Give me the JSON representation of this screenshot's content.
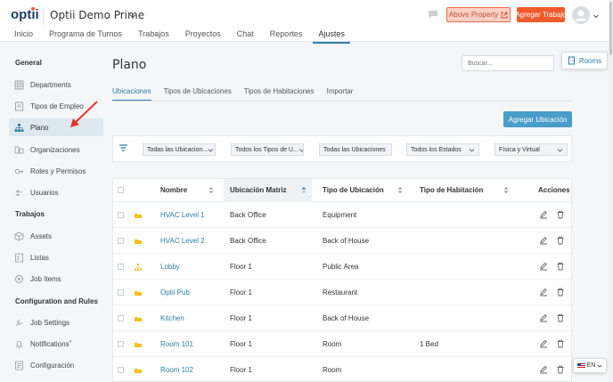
{
  "header": {
    "logo_text": "optii",
    "app_name": "Optii Demo Prime",
    "above_property_label": "Above Property",
    "add_work_label": "Agregar Trabajo",
    "nav": [
      {
        "label": "Inicio"
      },
      {
        "label": "Programa de Turnos"
      },
      {
        "label": "Trabajos"
      },
      {
        "label": "Proyectos"
      },
      {
        "label": "Chat"
      },
      {
        "label": "Reportes"
      },
      {
        "label": "Ajustes",
        "active": true
      }
    ]
  },
  "sidebar": {
    "sections": [
      {
        "title": "General",
        "items": [
          {
            "label": "Departments",
            "icon": "grid-icon"
          },
          {
            "label": "Tipos de Empleo",
            "icon": "id-card-icon"
          },
          {
            "label": "Plano",
            "icon": "org-chart-icon",
            "active": true
          },
          {
            "label": "Organizaciones",
            "icon": "organization-icon"
          },
          {
            "label": "Roles y Permisos",
            "icon": "key-icon"
          },
          {
            "label": "Usuarios",
            "icon": "users-icon"
          }
        ]
      },
      {
        "title": "Trabajos",
        "items": [
          {
            "label": "Assets",
            "icon": "cube-icon"
          },
          {
            "label": "Listas",
            "icon": "checklist-icon"
          },
          {
            "label": "Job Items",
            "icon": "badge-icon"
          }
        ]
      },
      {
        "title": "Configuration and Rules",
        "items": [
          {
            "label": "Job Settings",
            "icon": "wrench-icon"
          },
          {
            "label": "Notifications",
            "icon": "bell-icon",
            "superscript": "+"
          },
          {
            "label": "Configuración",
            "icon": "settings-list-icon"
          }
        ]
      }
    ]
  },
  "main": {
    "title": "Plano",
    "search_placeholder": "Buscar...",
    "rooms_label": "Rooms",
    "subtabs": [
      {
        "label": "Ubicaciones",
        "active": true
      },
      {
        "label": "Tipos de Ubicaciones"
      },
      {
        "label": "Tipos de Habitaciones"
      },
      {
        "label": "Importar"
      }
    ],
    "add_location_label": "Agregar Ubicación",
    "filters": [
      "Todas las Ubicacion...",
      "Todos los Tipos de U...",
      "Todas las Ubicaciones",
      "Todos los Estados",
      "Física y Virtual"
    ],
    "table": {
      "columns": [
        "Nombre",
        "Ubicación Matriz",
        "Tipo de Ubicación",
        "Tipo de Habitación",
        "Acciones"
      ],
      "rows": [
        {
          "name": "HVAC Level 1",
          "parent": "Back Office",
          "type": "Equipment",
          "room_type": "",
          "icon": "folder-icon"
        },
        {
          "name": "HVAC Level 2",
          "parent": "Back Office",
          "type": "Back of House",
          "room_type": "",
          "icon": "folder-icon"
        },
        {
          "name": "Lobby",
          "parent": "Floor 1",
          "type": "Public Area",
          "room_type": "",
          "icon": "hierarchy-icon"
        },
        {
          "name": "Optii Pub",
          "parent": "Floor 1",
          "type": "Restaurant",
          "room_type": "",
          "icon": "folder-icon"
        },
        {
          "name": "Kitchen",
          "parent": "Floor 1",
          "type": "Back of House",
          "room_type": "",
          "icon": "folder-icon"
        },
        {
          "name": "Room 101",
          "parent": "Floor 1",
          "type": "Room",
          "room_type": "1 Bed",
          "icon": "folder-icon"
        },
        {
          "name": "Room 102",
          "parent": "Floor 1",
          "type": "Room",
          "room_type": "",
          "icon": "folder-icon"
        }
      ]
    }
  },
  "language": {
    "code": "EN"
  },
  "colors": {
    "accent": "#2d7ea5",
    "orange": "#ef5b2c",
    "folder": "#f3c11b"
  }
}
